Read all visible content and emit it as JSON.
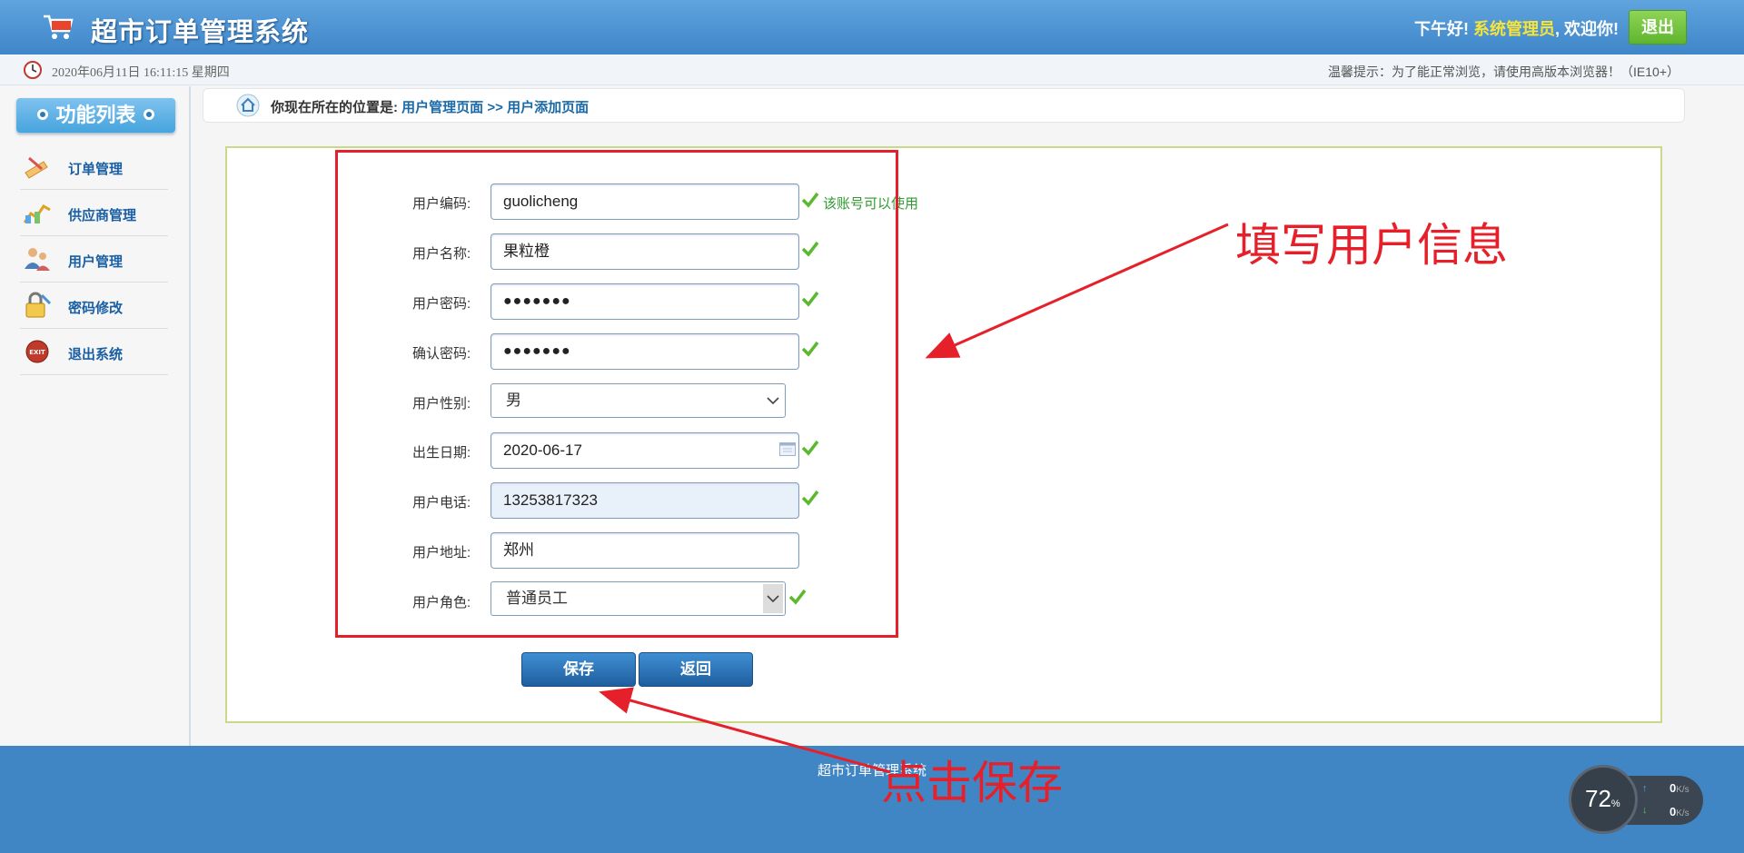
{
  "header": {
    "title": "超市订单管理系统",
    "greeting_prefix": "下午好!",
    "user_name": "系统管理员",
    "greeting_suffix": ", 欢迎你!",
    "logout_label": "退出"
  },
  "subbar": {
    "datetime": "2020年06月11日 16:11:15 星期四",
    "tip": "温馨提示：为了能正常浏览，请使用高版本浏览器！（IE10+）"
  },
  "sidebar": {
    "title": "功能列表",
    "items": [
      {
        "label": "订单管理",
        "icon": "order-icon"
      },
      {
        "label": "供应商管理",
        "icon": "supplier-icon"
      },
      {
        "label": "用户管理",
        "icon": "users-icon"
      },
      {
        "label": "密码修改",
        "icon": "lock-icon"
      },
      {
        "label": "退出系统",
        "icon": "exit-icon"
      }
    ]
  },
  "breadcrumb": {
    "prefix": "你现在所在的位置是:",
    "page1": "用户管理页面",
    "sep": ">>",
    "page2": "用户添加页面"
  },
  "form": {
    "code_label": "用户编码:",
    "code_value": "guolicheng",
    "code_ok": "该账号可以使用",
    "name_label": "用户名称:",
    "name_value": "果粒橙",
    "pwd_label": "用户密码:",
    "pwd_value": "●●●●●●●",
    "rpwd_label": "确认密码:",
    "rpwd_value": "●●●●●●●",
    "gender_label": "用户性别:",
    "gender_value": "男",
    "birth_label": "出生日期:",
    "birth_value": "2020-06-17",
    "phone_label": "用户电话:",
    "phone_value": "13253817323",
    "addr_label": "用户地址:",
    "addr_value": "郑州",
    "role_label": "用户角色:",
    "role_value": "普通员工",
    "save_label": "保存",
    "back_label": "返回"
  },
  "annotations": {
    "fill_info": "填写用户信息",
    "click_save": "点击保存"
  },
  "footer": {
    "text": "超市订单管理系统"
  },
  "speed_widget": {
    "percent": "72",
    "percent_unit": "%",
    "up_rate": "0",
    "down_rate": "0",
    "unit": "K/s"
  },
  "colors": {
    "header_blue": "#4a90d4",
    "annotation_red": "#e6202a",
    "accent_green": "#5fb52e",
    "footer_blue": "#4186c4"
  }
}
